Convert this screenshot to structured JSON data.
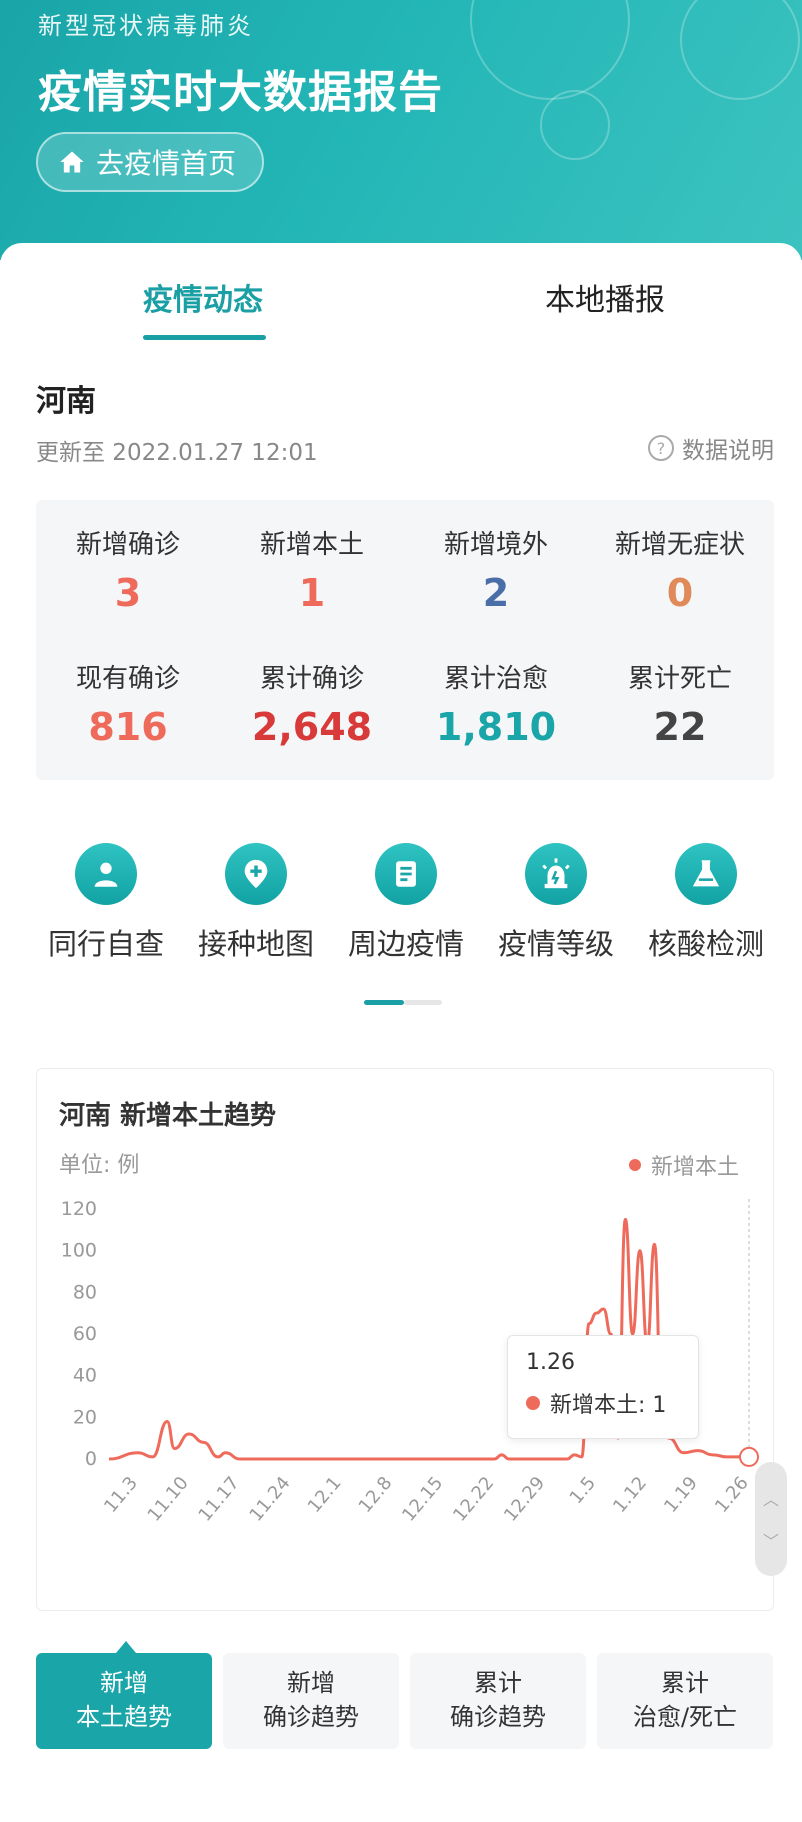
{
  "header": {
    "subtitle": "新型冠状病毒肺炎",
    "title": "疫情实时大数据报告",
    "home_button": "去疫情首页"
  },
  "tabs": [
    {
      "label": "疫情动态",
      "active": true
    },
    {
      "label": "本地播报",
      "active": false
    }
  ],
  "region": {
    "name": "河南",
    "updated": "更新至 2022.01.27 12:01",
    "data_note": "数据说明"
  },
  "stats": [
    {
      "label": "新增确诊",
      "value": "3",
      "color": "#ee6b5c"
    },
    {
      "label": "新增本土",
      "value": "1",
      "color": "#ee6b5c"
    },
    {
      "label": "新增境外",
      "value": "2",
      "color": "#4a6ea8"
    },
    {
      "label": "新增无症状",
      "value": "0",
      "color": "#e08a5a"
    },
    {
      "label": "现有确诊",
      "value": "816",
      "color": "#ee6b5c"
    },
    {
      "label": "累计确诊",
      "value": "2,648",
      "color": "#d83a3a"
    },
    {
      "label": "累计治愈",
      "value": "1,810",
      "color": "#1aa5a8"
    },
    {
      "label": "累计死亡",
      "value": "22",
      "color": "#444444"
    }
  ],
  "quick_links": [
    {
      "label": "同行自查",
      "icon": "person-icon"
    },
    {
      "label": "接种地图",
      "icon": "map-pin-plus-icon"
    },
    {
      "label": "周边疫情",
      "icon": "document-icon"
    },
    {
      "label": "疫情等级",
      "icon": "alarm-light-icon"
    },
    {
      "label": "核酸检测",
      "icon": "flask-icon"
    }
  ],
  "chart_section": {
    "title": "河南 新增本土趋势",
    "unit": "单位: 例",
    "legend": "新增本土",
    "tooltip_date": "1.26",
    "tooltip_value": "新增本土: 1"
  },
  "chart_data": {
    "type": "line",
    "title": "河南 新增本土趋势",
    "ylabel": "单位: 例",
    "ylim": [
      0,
      120
    ],
    "yticks": [
      0,
      20,
      40,
      60,
      80,
      100,
      120
    ],
    "xticks": [
      "11.3",
      "11.10",
      "11.17",
      "11.24",
      "12.1",
      "12.8",
      "12.15",
      "12.22",
      "12.29",
      "1.5",
      "1.12",
      "1.19",
      "1.26"
    ],
    "series": [
      {
        "name": "新增本土",
        "color": "#ee6b5c",
        "points": [
          [
            "10.30",
            0
          ],
          [
            "11.3",
            3
          ],
          [
            "11.5",
            1
          ],
          [
            "11.7",
            18
          ],
          [
            "11.8",
            5
          ],
          [
            "11.10",
            12
          ],
          [
            "11.12",
            8
          ],
          [
            "11.14",
            1
          ],
          [
            "11.15",
            3
          ],
          [
            "11.17",
            0
          ],
          [
            "11.24",
            0
          ],
          [
            "12.1",
            0
          ],
          [
            "12.8",
            0
          ],
          [
            "12.15",
            0
          ],
          [
            "12.22",
            0
          ],
          [
            "12.23",
            2
          ],
          [
            "12.24",
            0
          ],
          [
            "12.29",
            0
          ],
          [
            "1.1",
            0
          ],
          [
            "1.2",
            2
          ],
          [
            "1.3",
            1
          ],
          [
            "1.4",
            65
          ],
          [
            "1.5",
            70
          ],
          [
            "1.6",
            72
          ],
          [
            "1.7",
            60
          ],
          [
            "1.8",
            10
          ],
          [
            "1.9",
            115
          ],
          [
            "1.10",
            60
          ],
          [
            "1.11",
            100
          ],
          [
            "1.12",
            55
          ],
          [
            "1.13",
            103
          ],
          [
            "1.14",
            20
          ],
          [
            "1.15",
            10
          ],
          [
            "1.17",
            3
          ],
          [
            "1.19",
            4
          ],
          [
            "1.21",
            2
          ],
          [
            "1.23",
            1
          ],
          [
            "1.26",
            1
          ]
        ]
      }
    ]
  },
  "trend_buttons": [
    {
      "line1": "新增",
      "line2": "本土趋势",
      "active": true
    },
    {
      "line1": "新增",
      "line2": "确诊趋势",
      "active": false
    },
    {
      "line1": "累计",
      "line2": "确诊趋势",
      "active": false
    },
    {
      "line1": "累计",
      "line2": "治愈/死亡",
      "active": false
    }
  ]
}
